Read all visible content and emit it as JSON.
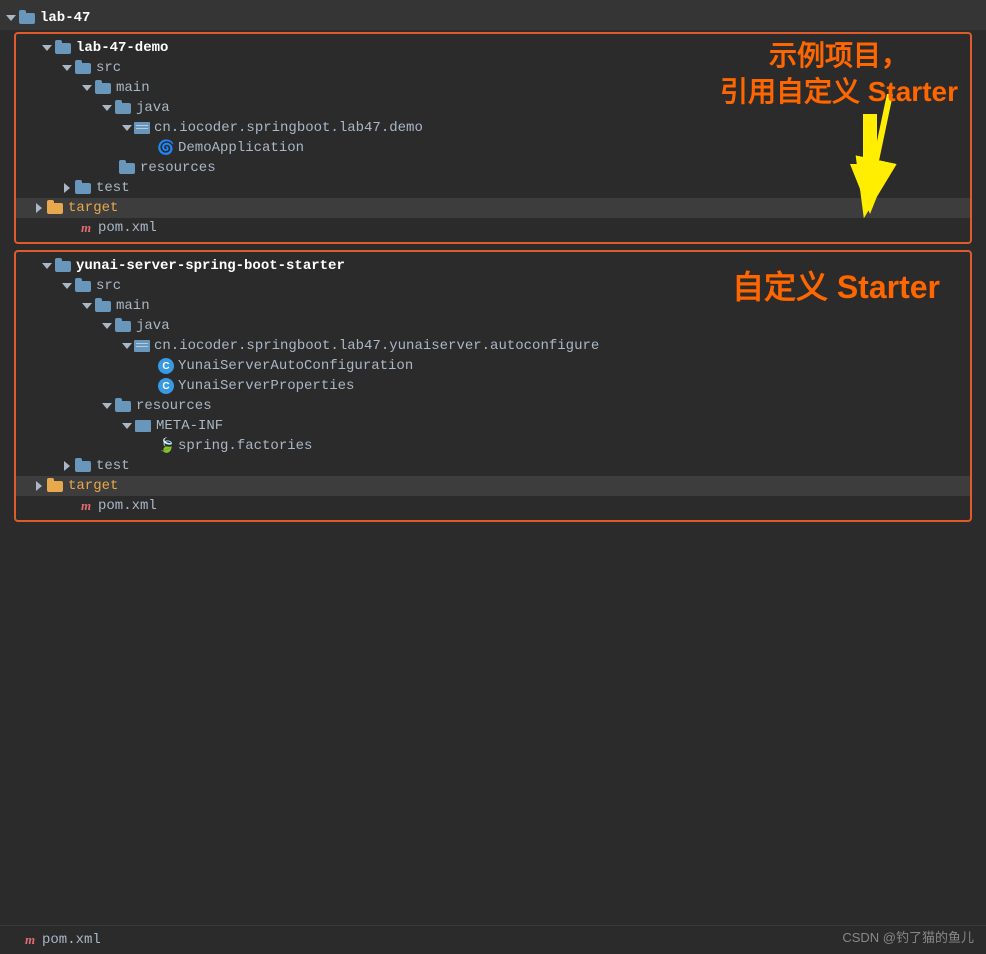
{
  "theme": {
    "bg": "#2b2b2b",
    "text": "#a9b7c6",
    "accent_orange": "#e05b2a",
    "selected_bg": "#3d3d3d"
  },
  "root": {
    "label": "lab-47"
  },
  "section1": {
    "box_label": "示例项目，\n引用自定义 Starter",
    "root_label": "lab-47-demo",
    "items": [
      {
        "id": "src1",
        "label": "src",
        "indent": 1,
        "type": "folder",
        "open": true
      },
      {
        "id": "main1",
        "label": "main",
        "indent": 2,
        "type": "folder",
        "open": true
      },
      {
        "id": "java1",
        "label": "java",
        "indent": 3,
        "type": "folder",
        "open": true
      },
      {
        "id": "pkg1",
        "label": "cn.iocoder.springboot.lab47.demo",
        "indent": 4,
        "type": "package",
        "open": true
      },
      {
        "id": "app1",
        "label": "DemoApplication",
        "indent": 5,
        "type": "spring"
      },
      {
        "id": "res1",
        "label": "resources",
        "indent": 3,
        "type": "resources"
      },
      {
        "id": "test1",
        "label": "test",
        "indent": 1,
        "type": "folder",
        "open": false
      },
      {
        "id": "target1",
        "label": "target",
        "indent": 0,
        "type": "folder-orange",
        "open": false,
        "highlighted": true
      },
      {
        "id": "pom1",
        "label": "pom.xml",
        "indent": 0,
        "type": "maven"
      }
    ]
  },
  "section2": {
    "box_label": "自定义 Starter",
    "root_label": "yunai-server-spring-boot-starter",
    "items": [
      {
        "id": "src2",
        "label": "src",
        "indent": 1,
        "type": "folder",
        "open": true
      },
      {
        "id": "main2",
        "label": "main",
        "indent": 2,
        "type": "folder",
        "open": true
      },
      {
        "id": "java2",
        "label": "java",
        "indent": 3,
        "type": "folder",
        "open": true
      },
      {
        "id": "pkg2",
        "label": "cn.iocoder.springboot.lab47.yunaiserver.autoconfigure",
        "indent": 4,
        "type": "package",
        "open": true
      },
      {
        "id": "cls1",
        "label": "YunaiServerAutoConfiguration",
        "indent": 5,
        "type": "class"
      },
      {
        "id": "cls2",
        "label": "YunaiServerProperties",
        "indent": 5,
        "type": "class"
      },
      {
        "id": "res2",
        "label": "resources",
        "indent": 3,
        "type": "resources",
        "open": true
      },
      {
        "id": "metainf",
        "label": "META-INF",
        "indent": 4,
        "type": "metainf",
        "open": true
      },
      {
        "id": "factories",
        "label": "spring.factories",
        "indent": 5,
        "type": "factories"
      },
      {
        "id": "test2",
        "label": "test",
        "indent": 1,
        "type": "folder",
        "open": false
      },
      {
        "id": "target2",
        "label": "target",
        "indent": 0,
        "type": "folder-orange",
        "open": false,
        "highlighted": true
      },
      {
        "id": "pom2",
        "label": "pom.xml",
        "indent": 0,
        "type": "maven"
      }
    ]
  },
  "bottom": {
    "pom_label": "pom.xml",
    "csdn_label": "CSDN @钓了猫的鱼儿"
  }
}
